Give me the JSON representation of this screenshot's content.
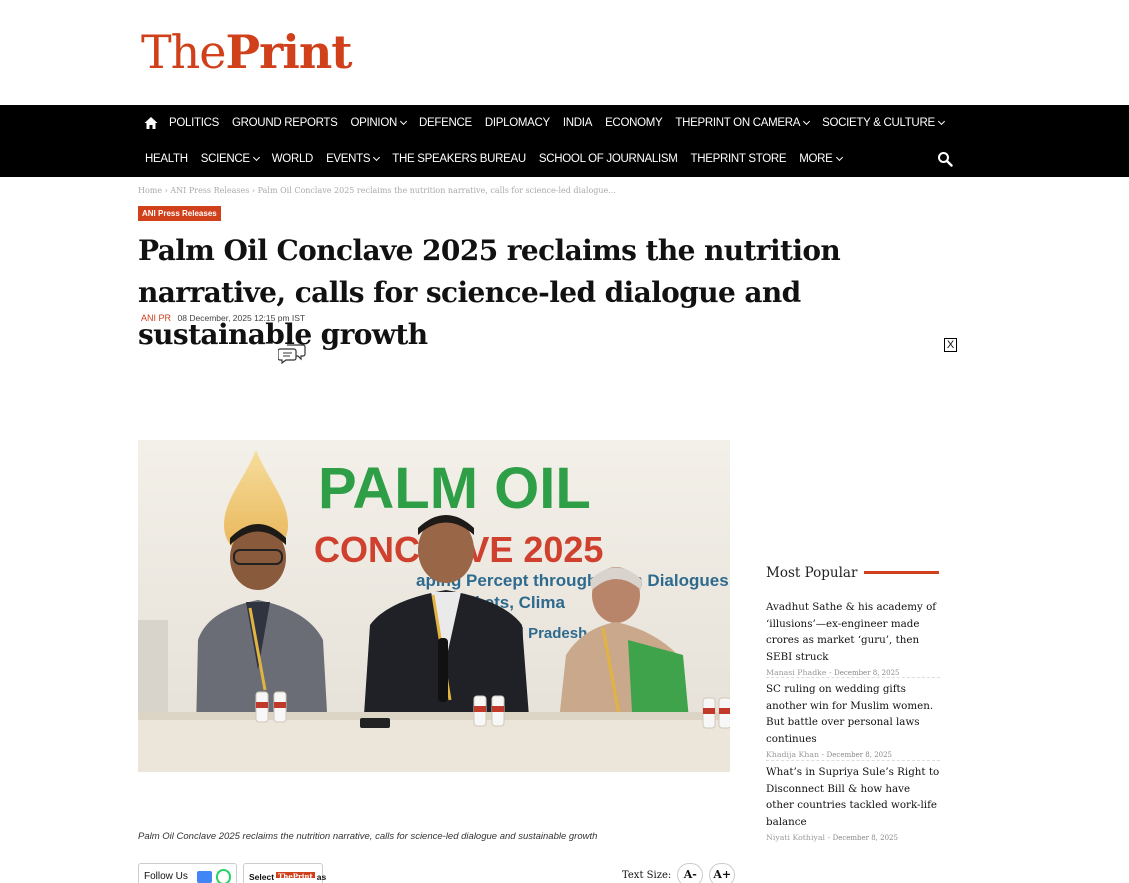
{
  "site": {
    "logo_light": "The",
    "logo_bold": "Print",
    "brand_color": "#d0401b"
  },
  "nav": {
    "row1": [
      {
        "label": "POLITICS",
        "dropdown": false
      },
      {
        "label": "GROUND REPORTS",
        "dropdown": false
      },
      {
        "label": "OPINION",
        "dropdown": true
      },
      {
        "label": "DEFENCE",
        "dropdown": false
      },
      {
        "label": "DIPLOMACY",
        "dropdown": false
      },
      {
        "label": "INDIA",
        "dropdown": false
      },
      {
        "label": "ECONOMY",
        "dropdown": false
      },
      {
        "label": "THEPRINT ON CAMERA",
        "dropdown": true
      },
      {
        "label": "SOCIETY & CULTURE",
        "dropdown": true
      }
    ],
    "row2": [
      {
        "label": "HEALTH",
        "dropdown": false
      },
      {
        "label": "SCIENCE",
        "dropdown": true
      },
      {
        "label": "WORLD",
        "dropdown": false
      },
      {
        "label": "EVENTS",
        "dropdown": true
      },
      {
        "label": "THE SPEAKERS BUREAU",
        "dropdown": false
      },
      {
        "label": "SCHOOL OF JOURNALISM",
        "dropdown": false
      },
      {
        "label": "THEPRINT STORE",
        "dropdown": false
      },
      {
        "label": "MORE",
        "dropdown": true
      }
    ]
  },
  "breadcrumb": "Home › ANI Press Releases › Palm Oil Conclave 2025 reclaims the nutrition narrative, calls for science-led dialogue...",
  "article": {
    "category": "ANI Press Releases",
    "headline": "Palm Oil Conclave 2025 reclaims the nutrition narrative, calls for science-led dialogue and sustainable growth",
    "author": "ANI PR",
    "date": "08 December, 2025 12:15 pm IST",
    "close_label": "X",
    "photo_banner_line1": "PALM OIL",
    "photo_banner_line2": "CONCLAVE 2025",
    "photo_banner_line3": "aping Percept    through Palm   Dialogues",
    "photo_banner_line4": "Heal         ets, Clima",
    "photo_banner_line5": "y, 6 D         Bhopal           Pradesh",
    "caption": "Palm Oil Conclave 2025 reclaims the nutrition narrative, calls for science-led dialogue and sustainable growth"
  },
  "share": {
    "follow_label": "Follow Us :",
    "select_label": "Select",
    "select_logo": "ThePrint",
    "select_suffix": "as",
    "text_size_label": "Text Size:",
    "decrease": "A-",
    "increase": "A+"
  },
  "popular": {
    "title": "Most Popular",
    "items": [
      {
        "title": "Avadhut Sathe & his academy of ‘illusions’—ex-engineer made crores as market ‘guru’, then SEBI struck",
        "author": "Manasi Phadke",
        "date": "December 8, 2025"
      },
      {
        "title": "SC ruling on wedding gifts another win for Muslim women. But battle over personal laws continues",
        "author": "Khadija Khan",
        "date": "December 8, 2025"
      },
      {
        "title": "What’s in Supriya Sule’s Right to Disconnect Bill & how have other countries tackled work-life balance",
        "author": "Niyati Kothiyal",
        "date": "December 8, 2025"
      }
    ]
  }
}
